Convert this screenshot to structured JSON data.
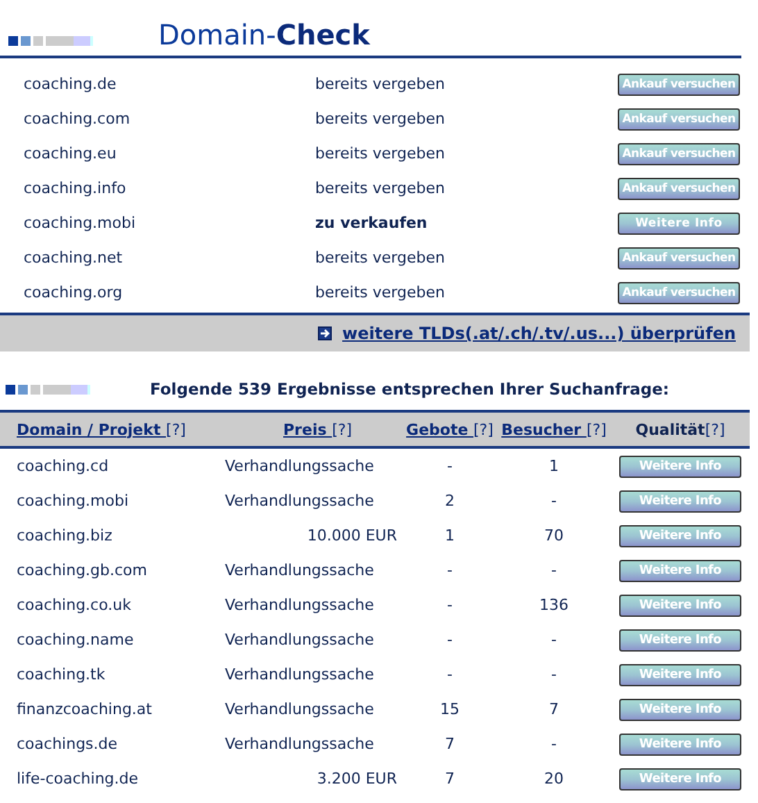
{
  "title": {
    "plain": "Domain-",
    "bold": "Check"
  },
  "check_rows": [
    {
      "domain": "coaching.de",
      "status": "bereits vergeben",
      "kind": "taken",
      "button": "Ankauf versuchen"
    },
    {
      "domain": "coaching.com",
      "status": "bereits vergeben",
      "kind": "taken",
      "button": "Ankauf versuchen"
    },
    {
      "domain": "coaching.eu",
      "status": "bereits vergeben",
      "kind": "taken",
      "button": "Ankauf versuchen"
    },
    {
      "domain": "coaching.info",
      "status": "bereits vergeben",
      "kind": "taken",
      "button": "Ankauf versuchen"
    },
    {
      "domain": "coaching.mobi",
      "status": "zu verkaufen",
      "kind": "for_sale",
      "button": "Weitere Info"
    },
    {
      "domain": "coaching.net",
      "status": "bereits vergeben",
      "kind": "taken",
      "button": "Ankauf versuchen"
    },
    {
      "domain": "coaching.org",
      "status": "bereits vergeben",
      "kind": "taken",
      "button": "Ankauf versuchen"
    }
  ],
  "more_tlds_link": "weitere TLDs(.at/.ch/.tv/.us...) überprüfen",
  "results_heading": "Folgende 539 Ergebnisse entsprechen Ihrer Suchanfrage:",
  "columns": [
    {
      "label": "Domain / Projekt ",
      "help": "[?]",
      "sortable": true
    },
    {
      "label": "Preis ",
      "help": "[?]",
      "sortable": true
    },
    {
      "label": "Gebote ",
      "help": "[?]",
      "sortable": true
    },
    {
      "label": "Besucher ",
      "help": "[?]",
      "sortable": true
    },
    {
      "label": "Qualität",
      "help": "[?]",
      "sortable": false
    }
  ],
  "rows": [
    {
      "domain": "coaching.cd",
      "price": "Verhandlungssache",
      "bids": "-",
      "visitors": "1",
      "button": "Weitere Info"
    },
    {
      "domain": "coaching.mobi",
      "price": "Verhandlungssache",
      "bids": "2",
      "visitors": "-",
      "button": "Weitere Info"
    },
    {
      "domain": "coaching.biz",
      "price": "10.000 EUR",
      "bids": "1",
      "visitors": "70",
      "button": "Weitere Info"
    },
    {
      "domain": "coaching.gb.com",
      "price": "Verhandlungssache",
      "bids": "-",
      "visitors": "-",
      "button": "Weitere Info"
    },
    {
      "domain": "coaching.co.uk",
      "price": "Verhandlungssache",
      "bids": "-",
      "visitors": "136",
      "button": "Weitere Info"
    },
    {
      "domain": "coaching.name",
      "price": "Verhandlungssache",
      "bids": "-",
      "visitors": "-",
      "button": "Weitere Info"
    },
    {
      "domain": "coaching.tk",
      "price": "Verhandlungssache",
      "bids": "-",
      "visitors": "-",
      "button": "Weitere Info"
    },
    {
      "domain": "finanzcoaching.at",
      "price": "Verhandlungssache",
      "bids": "15",
      "visitors": "7",
      "button": "Weitere Info"
    },
    {
      "domain": "coachings.de",
      "price": "Verhandlungssache",
      "bids": "7",
      "visitors": "-",
      "button": "Weitere Info"
    },
    {
      "domain": "life-coaching.de",
      "price": "3.200 EUR",
      "bids": "7",
      "visitors": "20",
      "button": "Weitere Info"
    }
  ]
}
